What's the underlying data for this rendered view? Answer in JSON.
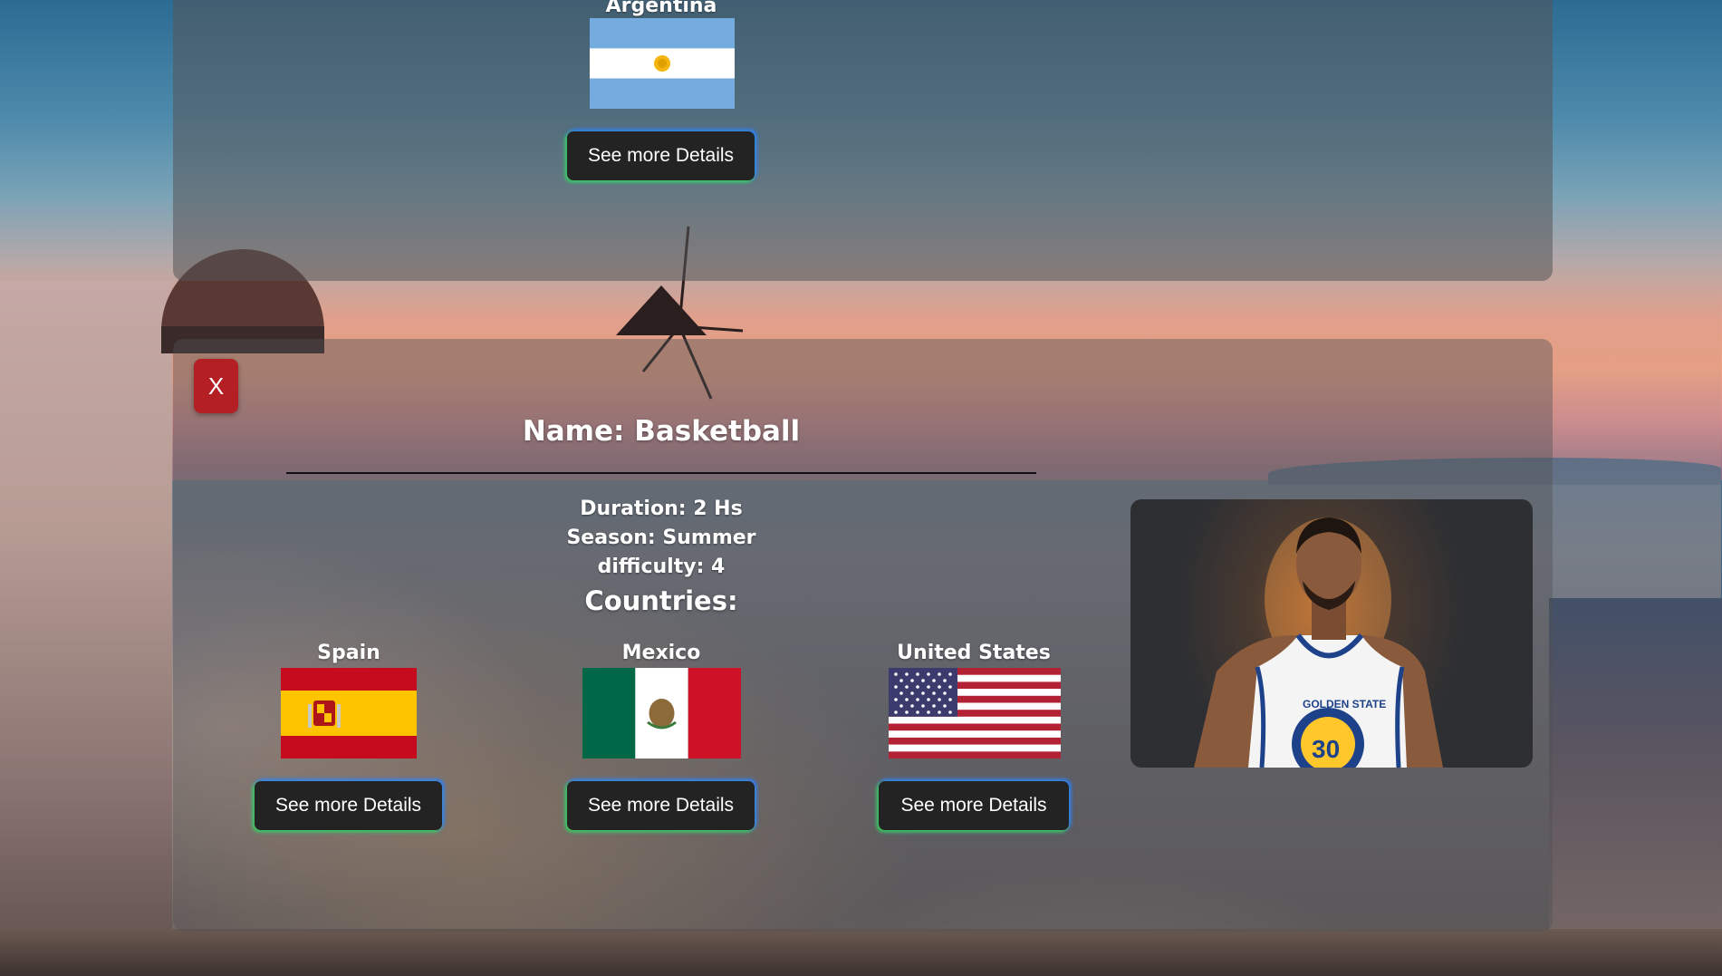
{
  "top_card": {
    "country": {
      "name": "Argentina",
      "button_label": "See more Details"
    }
  },
  "activity": {
    "close_label": "X",
    "name": "Name: Basketball",
    "duration": "Duration: 2 Hs",
    "season": "Season: Summer",
    "difficulty": "difficulty: 4",
    "countries_heading": "Countries:",
    "countries": [
      {
        "name": "Spain",
        "button_label": "See more Details"
      },
      {
        "name": "Mexico",
        "button_label": "See more Details"
      },
      {
        "name": "United States",
        "button_label": "See more Details"
      }
    ],
    "photo": {
      "jersey_text": "GOLDEN STATE",
      "jersey_number": "30"
    }
  },
  "colors": {
    "close_button": "#b41f24",
    "button_bg": "#232323",
    "button_glow_green": "#39d353",
    "button_glow_blue": "#2b7cff"
  }
}
